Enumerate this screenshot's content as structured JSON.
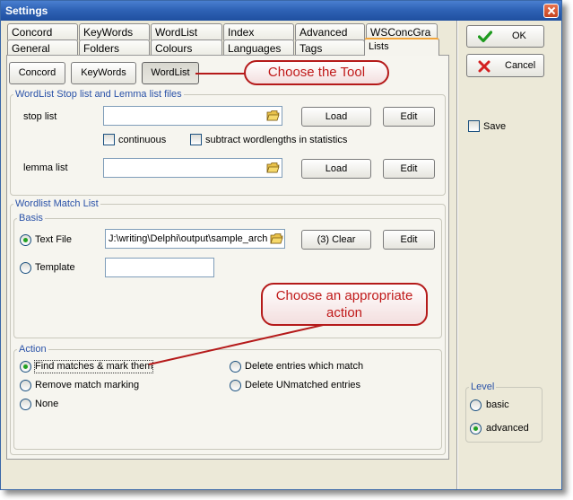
{
  "window": {
    "title": "Settings"
  },
  "tabs": {
    "row1": [
      "Concord",
      "KeyWords",
      "WordList",
      "Index",
      "Advanced",
      "WSConcGra"
    ],
    "row2": [
      "General",
      "Folders",
      "Colours",
      "Languages",
      "Tags",
      "Lists"
    ]
  },
  "tool_buttons": {
    "concord": "Concord",
    "keywords": "KeyWords",
    "wordlist": "WordList"
  },
  "callouts": {
    "tool": "Choose the Tool",
    "action": "Choose an appropriate action"
  },
  "stoplist_group": {
    "title": "WordList Stop list and Lemma list files",
    "stop_label": "stop list",
    "stop_value": "",
    "load": "Load",
    "edit": "Edit",
    "continuous": "continuous",
    "subtract": "subtract wordlengths in statistics",
    "lemma_label": "lemma list",
    "lemma_value": ""
  },
  "match_group": {
    "title": "Wordlist Match List",
    "basis_title": "Basis",
    "text_file": "Text File",
    "text_file_value": "J:\\writing\\Delphi\\output\\sample_arch",
    "clear": "(3) Clear",
    "edit": "Edit",
    "template": "Template",
    "template_value": ""
  },
  "action_group": {
    "title": "Action",
    "find": "Find matches & mark them",
    "remove": "Remove match marking",
    "none": "None",
    "delete_match": "Delete entries which match",
    "delete_unmatched": "Delete UNmatched entries"
  },
  "right_panel": {
    "ok": "OK",
    "cancel": "Cancel",
    "save": "Save",
    "level_title": "Level",
    "basic": "basic",
    "advanced": "advanced"
  },
  "colors": {
    "title_bar": "#2f63b6",
    "callout_border": "#b51a1a",
    "callout_text": "#c01a1a",
    "group_label": "#2a52a8",
    "active_tab_accent": "#f2a53a"
  },
  "icons": {
    "ok": "green-check-icon",
    "cancel": "red-x-icon",
    "browse": "folder-open-icon",
    "close": "close-icon"
  }
}
